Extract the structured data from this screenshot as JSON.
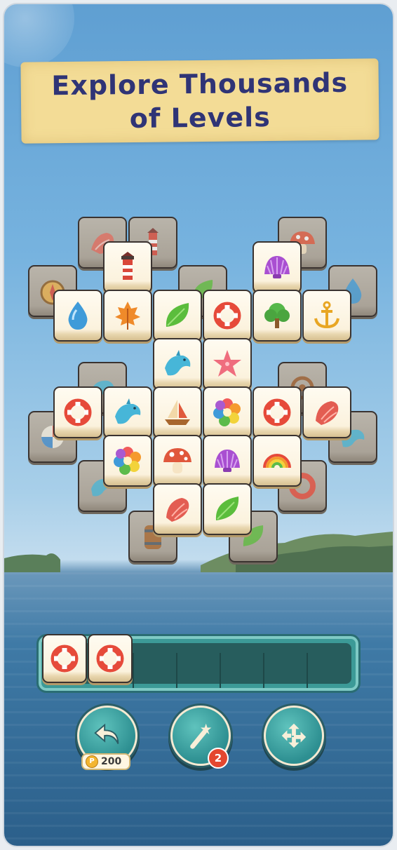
{
  "banner": {
    "line1": "Explore Thousands",
    "line2": "of Levels"
  },
  "colors": {
    "banner_text": "#2f3476",
    "banner_bg": "#f3dc96",
    "tray": "#3c9a97",
    "control_button": "#2d8f91",
    "badge": "#e4472f"
  },
  "board": {
    "under_tiles": [
      "shell",
      "lighthouse",
      "mushroom",
      "compass",
      "leaf",
      "water-drop",
      "dolphin",
      "life-ring",
      "barrel",
      "ship-wheel",
      "beach-ball",
      "shell",
      "dolphin",
      "life-ring",
      "leaf",
      "barrel"
    ],
    "top_tiles": [
      "lighthouse",
      "shell",
      "water-drop",
      "maple-leaf",
      "leaf",
      "life-ring",
      "tree",
      "anchor",
      "dolphin",
      "starfish",
      "life-ring",
      "dolphin",
      "sailboat",
      "flower",
      "life-ring",
      "conch",
      "flower",
      "mushroom",
      "shell",
      "rainbow",
      "conch",
      "leaf"
    ]
  },
  "tray": {
    "slots": 7,
    "items": [
      "life-ring",
      "life-ring"
    ]
  },
  "controls": {
    "undo": {
      "icon": "undo-arrow-icon",
      "cost": "200",
      "coin_symbol": "P"
    },
    "magic": {
      "icon": "magic-wand-icon",
      "badge": "2"
    },
    "shuffle": {
      "icon": "shuffle-icon"
    }
  }
}
